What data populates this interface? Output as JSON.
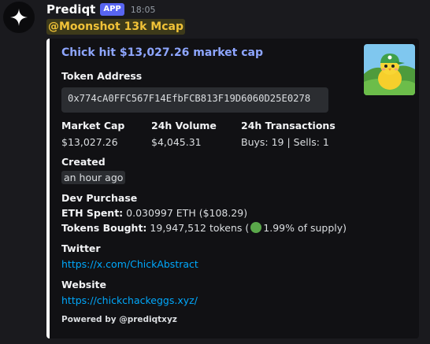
{
  "message": {
    "username": "Prediqt",
    "badge": "APP",
    "timestamp": "18:05",
    "mention": "@Moonshot 13k Mcap"
  },
  "embed": {
    "title": "Chick  hit $13,027.26 market cap",
    "token_address_label": "Token Address",
    "token_address": "0x774cA0FFC567F14EfbFCB813F19D6060D25E0278",
    "market_cap_label": "Market Cap",
    "market_cap": "$13,027.26",
    "volume_label": "24h Volume",
    "volume": "$4,045.31",
    "tx_label": "24h Transactions",
    "tx": "Buys: 19 | Sells: 1",
    "created_label": "Created",
    "created": "an hour ago",
    "dev_label": "Dev Purchase",
    "eth_spent_label": "ETH Spent:",
    "eth_spent": "0.030997 ETH ($108.29)",
    "tokens_bought_label": "Tokens Bought:",
    "tokens_bought": "19,947,512 tokens (",
    "tokens_bought_pct": "1.99% of supply)",
    "twitter_label": "Twitter",
    "twitter_url": "https://x.com/ChickAbstract",
    "website_label": "Website",
    "website_url": "https://chickchackeggs.xyz/",
    "footer": "Powered by @prediqtxyz"
  },
  "colors": {
    "accent_bar": "#ffffff",
    "title_link": "#8ea6ff",
    "link": "#00a8fc",
    "app_badge": "#5865f2",
    "mention_text": "#f0b232"
  },
  "icons": {
    "avatar": "sparkle-star-icon",
    "thumbnail": "chick-mascot-image",
    "supply_circle": "green-circle-icon"
  }
}
